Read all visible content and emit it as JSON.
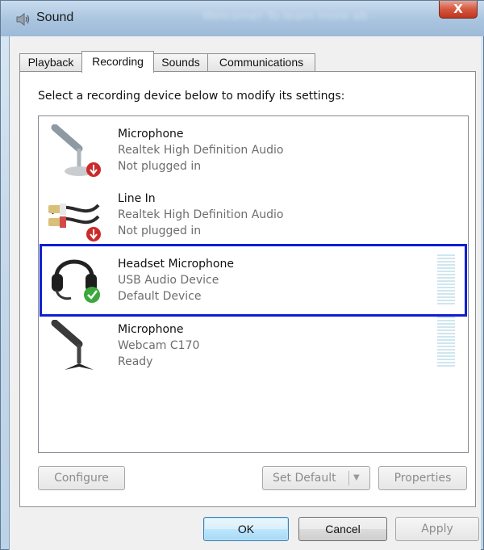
{
  "window": {
    "title": "Sound",
    "close_label": "X",
    "blurred_title": "Welcome! To learn more ab"
  },
  "tabs": [
    {
      "label": "Playback",
      "active": false
    },
    {
      "label": "Recording",
      "active": true
    },
    {
      "label": "Sounds",
      "active": false
    },
    {
      "label": "Communications",
      "active": false
    }
  ],
  "instruction": "Select a recording device below to modify its settings:",
  "devices": [
    {
      "name": "Microphone",
      "driver": "Realtek High Definition Audio",
      "status": "Not plugged in",
      "icon": "microphone-icon",
      "badge": "unplugged-badge-icon",
      "selected": false
    },
    {
      "name": "Line In",
      "driver": "Realtek High Definition Audio",
      "status": "Not plugged in",
      "icon": "line-in-cable-icon",
      "badge": "unplugged-badge-icon",
      "selected": false
    },
    {
      "name": "Headset Microphone",
      "driver": "USB Audio Device",
      "status": "Default Device",
      "icon": "headset-icon",
      "badge": "default-check-icon",
      "selected": true
    },
    {
      "name": "Microphone",
      "driver": "Webcam C170",
      "status": "Ready",
      "icon": "microphone-icon",
      "badge": "",
      "selected": false
    }
  ],
  "buttons": {
    "configure": "Configure",
    "set_default": "Set Default",
    "properties": "Properties",
    "ok": "OK",
    "cancel": "Cancel",
    "apply": "Apply"
  },
  "colors": {
    "selection_border": "#0f1fcf",
    "unplugged_badge": "#cc2a2a",
    "default_badge": "#3ca83c"
  }
}
